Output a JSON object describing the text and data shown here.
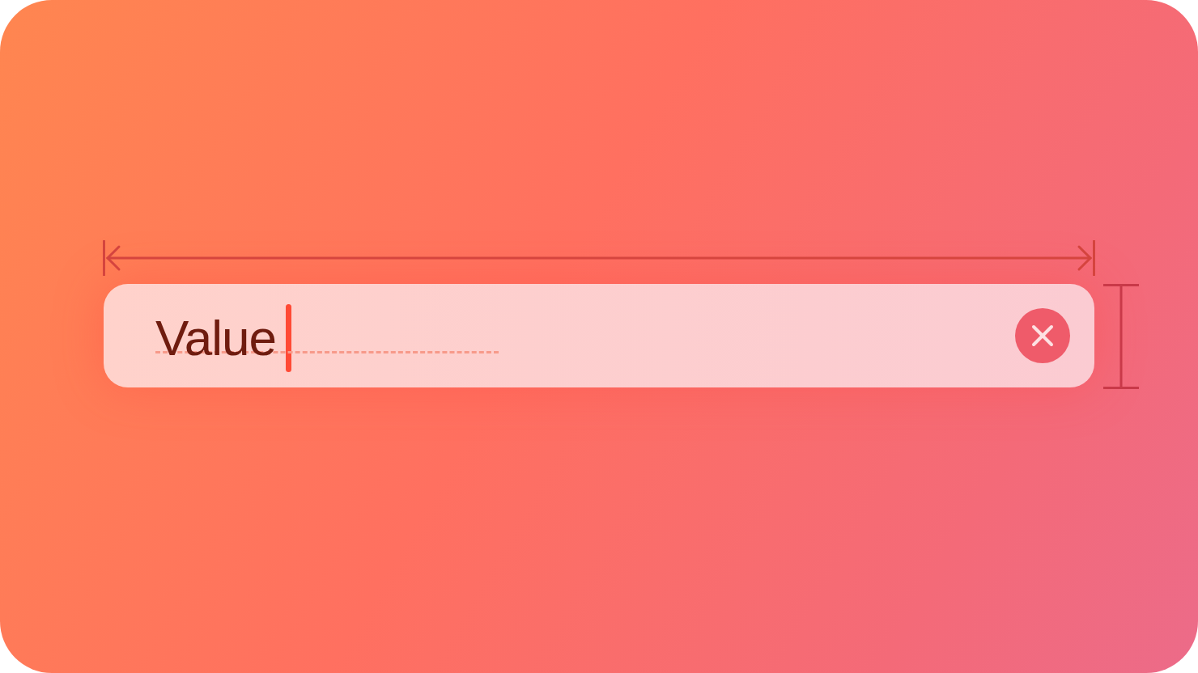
{
  "text_field": {
    "value": "Value",
    "focused": true,
    "clear_button": true
  }
}
